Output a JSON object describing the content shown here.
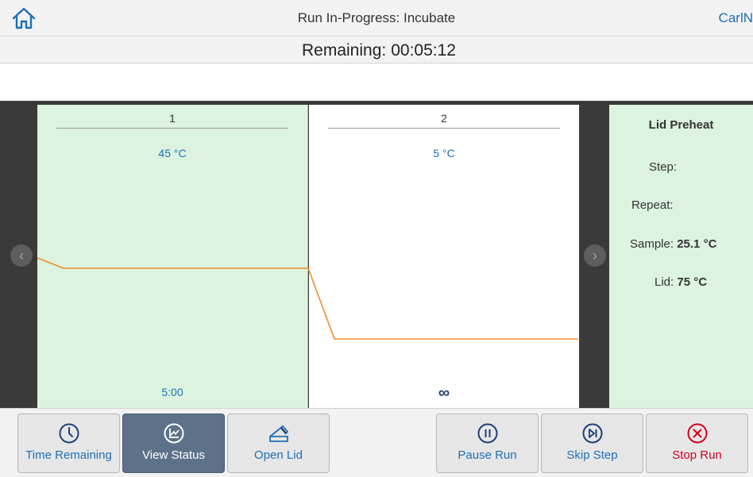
{
  "header": {
    "title": "Run In-Progress: Incubate",
    "user": "CarlN",
    "remaining_label": "Remaining:",
    "remaining_value": "00:05:12"
  },
  "steps": [
    {
      "number": "1",
      "temperature": "45 °C",
      "hold": "5:00"
    },
    {
      "number": "2",
      "temperature": "5 °C",
      "hold": "∞"
    }
  ],
  "info": {
    "title": "Lid Preheat",
    "step_label": "Step:",
    "repeat_label": "Repeat:",
    "sample_label": "Sample:",
    "sample_value": "25.1 °C",
    "lid_label": "Lid:",
    "lid_value": "75 °C"
  },
  "toolbar": {
    "time_remaining": "Time Remaining",
    "view_status": "View Status",
    "open_lid": "Open Lid",
    "pause_run": "Pause Run",
    "skip_step": "Skip Step",
    "stop_run": "Stop Run"
  },
  "icons": {
    "home": "home-icon",
    "nav_left": "chevron-left-icon",
    "nav_right": "chevron-right-icon",
    "time_remaining": "clock-icon",
    "view_status": "chart-icon",
    "open_lid": "lid-icon",
    "pause_run": "pause-icon",
    "skip_step": "skip-icon",
    "stop_run": "stop-icon"
  },
  "colors": {
    "accent": "#1f6fb5",
    "active_step_bg": "#dcf3df",
    "profile_line": "#f28c28",
    "stop": "#d0021b",
    "active_button": "#5d7288"
  }
}
